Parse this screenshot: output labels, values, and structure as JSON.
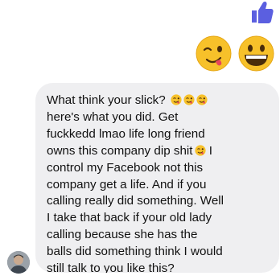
{
  "colors": {
    "like": "#5b5fe0",
    "bubble": "#efeff1",
    "text": "#111111",
    "emoji_face": "#f7c12a"
  },
  "icons": {
    "like": "thumbs-up-icon",
    "emoji_1": "zany-winking-face-emoji",
    "emoji_2": "grinning-face-emoji",
    "inline": "zany-face-emoji"
  },
  "message": {
    "lines": [
      "What think your slick?",
      "here's what you did. Get",
      "fuckkedd lmao life long friend",
      "owns this company dip shit",
      "control my Facebook not this",
      "company get a life. And if you",
      "calling really did something. Well",
      "I take that back if your old lady",
      "calling because she has the",
      "balls did something think I would",
      "still talk to you like this?"
    ],
    "line4_tail": "I"
  }
}
